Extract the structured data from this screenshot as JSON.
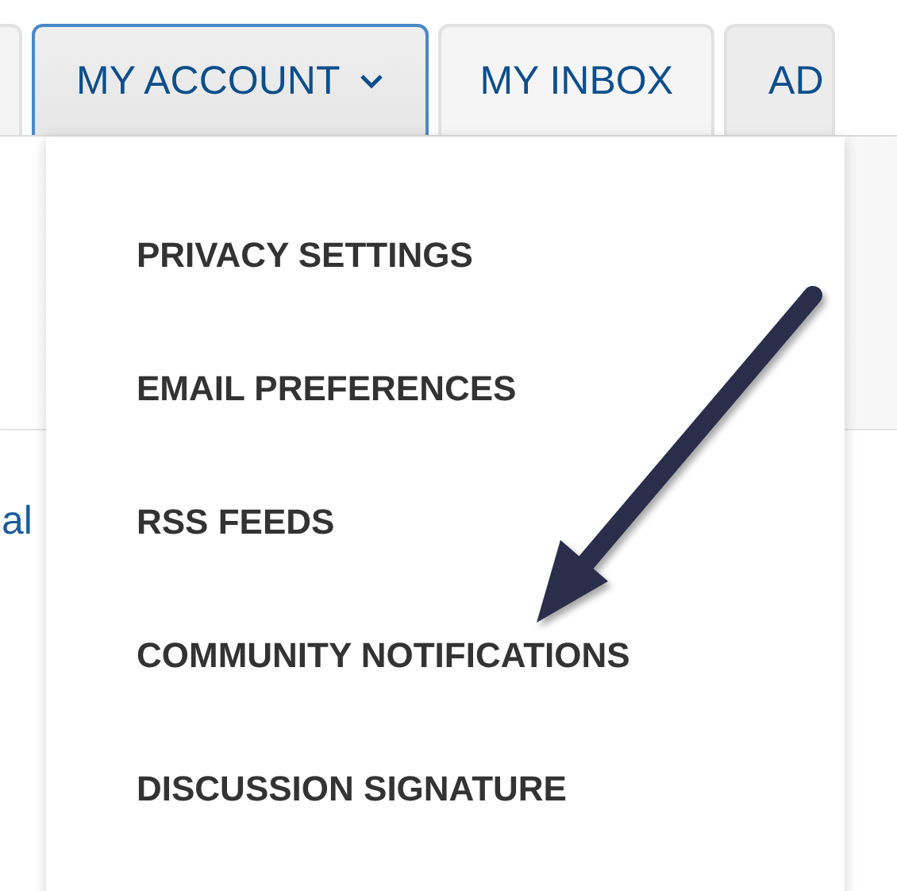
{
  "tabs": [
    {
      "label": "MY ACCOUNT",
      "selected": true,
      "dropdown": true
    },
    {
      "label": "MY INBOX",
      "selected": false,
      "dropdown": false
    },
    {
      "label": "AD",
      "selected": false,
      "dropdown": false
    }
  ],
  "menu": {
    "expanded": true,
    "items": [
      {
        "label": "PRIVACY SETTINGS"
      },
      {
        "label": "EMAIL PREFERENCES"
      },
      {
        "label": "RSS FEEDS"
      },
      {
        "label": "COMMUNITY NOTIFICATIONS"
      },
      {
        "label": "DISCUSSION SIGNATURE"
      }
    ]
  },
  "page_text": "al"
}
